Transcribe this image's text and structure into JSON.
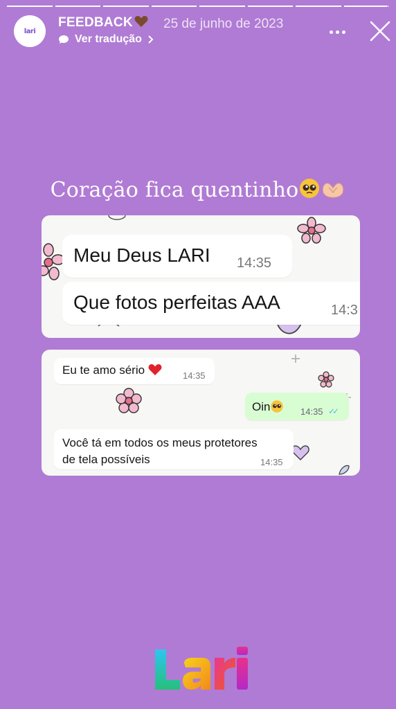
{
  "story": {
    "progress_segments": [
      1,
      1,
      1,
      1,
      1,
      1,
      1,
      0.95
    ],
    "account_avatar_text": "lari",
    "title": "FEEDBACK",
    "title_emoji": "brown-heart",
    "date": "25 de junho de 2023",
    "translate_label": "Ver tradução",
    "caption": "Coração fica quentinho"
  },
  "screenshot1": {
    "messages": [
      {
        "text": "Meu Deus LARI",
        "time": "14:35"
      },
      {
        "text": "Que fotos perfeitas AAA",
        "time": "14:3"
      }
    ]
  },
  "screenshot2": {
    "messages": [
      {
        "text": "Eu te amo sério",
        "time": "14:35",
        "emoji": "red-heart"
      },
      {
        "text": "Oin",
        "time": "14:35",
        "emoji": "pleading-face",
        "sent": true,
        "ticks": "✓✓"
      },
      {
        "text": "Você tá em todos os meus protetores de tela possíveis",
        "time": "14:35"
      }
    ]
  },
  "colors": {
    "background": "#b07bd4",
    "sent_bubble": "#d9fdd3",
    "read_ticks": "#53bdeb"
  },
  "logo_text": "LARI"
}
